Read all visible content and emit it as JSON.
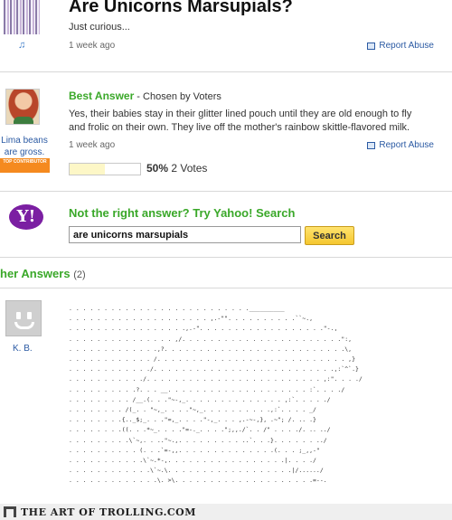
{
  "question": {
    "title": "Are Unicorns Marsupials?",
    "details": "Just curious...",
    "time": "1 week ago",
    "report_label": "Report Abuse",
    "thumb_note": "♫"
  },
  "best_answer": {
    "heading": "Best Answer",
    "chosen_by": " - Chosen by Voters",
    "text": "Yes, their babies stay in their glitter lined pouch until they are old enough to fly and frolic on their own. They live off the mother's rainbow skittle-flavored milk.",
    "time": "1 week ago",
    "report_label": "Report Abuse",
    "user_name": "Lima beans are gross.",
    "badge": "TOP CONTRIBUTOR",
    "vote_fraction": 0.5,
    "vote_percent": "50%",
    "vote_count": "2 Votes"
  },
  "search": {
    "logo": "Y!",
    "title": "Not the right answer? Try Yahoo! Search",
    "query": "are unicorns marsupials",
    "button": "Search"
  },
  "other_answers": {
    "heading": "her Answers",
    "count": "(2)",
    "user_name": "K. B.",
    "ascii_art": ". . . . . . . . . . . . . . . . . . . . . . . . . .__________\n. . . . . . . . . . . . . . . . . . . . ,.-\"\". . . . . . . . . .``~.,\n. . . . . . . . . . . . . . . . .,.-\". . . . . . . . . . . . . . . . . .\"-.,\n. . . . . . . . . . . . . . . ,/. . . . . . . . . . . . . . . . . . . . . . .\":,\n. . . . . . . . . . . . .,?. . . . . . . . . . . . . . . . . . . . . . . . . .\\,\n. . . . . . . . . . . . /. . . . . . . . . . . . . . . . . . . . . . . . . . . ,}\n. . . . . . . . . . . ./. . . . . . . . . . . . . . . . . . . . . . . . . .,:`^`.}\n. . . . . . . . . . ./. . . . . . . . . . . . . . . . . . . . . . . . . ,:\". . . ./\n. . . . . . . . . .?. . . __. . . . . . . . . . . . . . . . . . . . :`. . . ./\n. . . . . . . . . /__.(. . .\"~-,_. . . . . . . . . . . . . . ,:`. . . . ./\n. . . . . . . . /(_. . \"~,_. . . .\"~,_. . . . . . . . . .,:`. . . . _/\n. . . . . . . .{.._$;_. . .\"=,_. . . .\"-,_. . . ,.-~-,}, .~\"; /. .. .}\n. . . . . . . .((. . .*~_. . . .\"=-._. . . .\";,,./`. . /\" . . . ./. .. ../\n. . . . . . . . .\\`~,. . ..\"~.,. . . . . . . . . ..`. . .}. . . . . . ../\n. . . . . . . . . . (. . .`=-,,. . . . . . . . . . . . . .(. . . ;_,,-\"\n. . . . . . . . . . .\\`~.*-,. . . . . . . . . . . . . . . . .|. . . ./\n. . . . . . . . . . . .\\`~.\\. . . . . . . . . . . . . . . . . .|/....../\n. . . . . . . . . . . . .\\. >\\. . . . . . . . . . . . . . . . . . . .=--."
  },
  "watermark": "THE ART OF TROLLING.COM",
  "colors": {
    "green_heading": "#3aa829",
    "link_blue": "#2b5aa3",
    "yahoo_purple": "#7b1fa2",
    "search_button": "#f5c72f",
    "badge_orange": "#f58a1f"
  },
  "icons": {
    "report": "flag-icon",
    "question_thumb": "music-note-icon",
    "search_logo": "yahoo-logo",
    "default_avatar": "smiley-avatar"
  }
}
